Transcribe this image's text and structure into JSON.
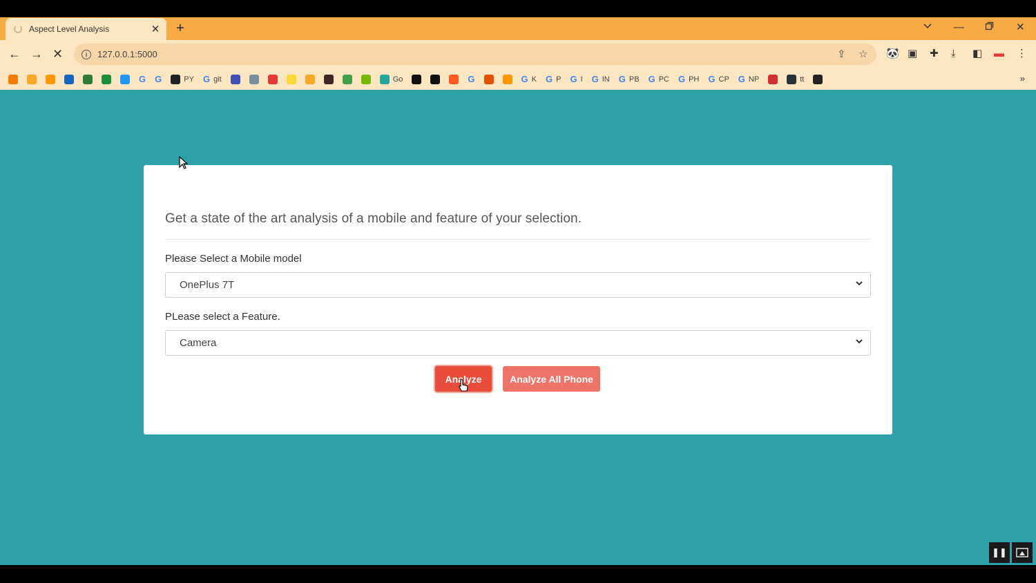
{
  "browser": {
    "tab_title": "Aspect Level Analysis",
    "url": "127.0.0.1:5000",
    "bookmarks": [
      {
        "icon": "arrow-fav-icon",
        "label": "",
        "color": "#f57c00"
      },
      {
        "icon": "orange-square-fav-icon",
        "label": "",
        "color": "#f9a825"
      },
      {
        "icon": "bars-fav-icon",
        "label": "",
        "color": "#ff9800"
      },
      {
        "icon": "ieee-fav-icon",
        "label": "",
        "color": "#1565c0"
      },
      {
        "icon": "green-circle-fav-icon",
        "label": "",
        "color": "#2e7d32"
      },
      {
        "icon": "plus-fav-icon",
        "label": "",
        "color": "#1b8e3a"
      },
      {
        "icon": "telegram-fav-icon",
        "label": "",
        "color": "#2196f3"
      },
      {
        "icon": "google-fav-icon",
        "label": "",
        "color": "#4285f4"
      },
      {
        "icon": "google-fav-icon",
        "label": "",
        "color": "#4285f4"
      },
      {
        "icon": "github-fav-icon",
        "label": "PY",
        "color": "#222222"
      },
      {
        "icon": "google-fav-icon",
        "label": "git",
        "color": "#4285f4"
      },
      {
        "icon": "blue-fav-icon",
        "label": "",
        "color": "#3f51b5"
      },
      {
        "icon": "stack-fav-icon",
        "label": "",
        "color": "#78909c"
      },
      {
        "icon": "youtube-fav-icon",
        "label": "",
        "color": "#e53935"
      },
      {
        "icon": "yellow-p-fav-icon",
        "label": "",
        "color": "#fdd835"
      },
      {
        "icon": "folder-fav-icon",
        "label": "",
        "color": "#f9a825"
      },
      {
        "icon": "dark-circle-fav-icon",
        "label": "",
        "color": "#3e2723"
      },
      {
        "icon": "green-ring-fav-icon",
        "label": "",
        "color": "#43a047"
      },
      {
        "icon": "nvidia-fav-icon",
        "label": "",
        "color": "#76b900"
      },
      {
        "icon": "web-fav-icon",
        "label": "Go",
        "color": "#26a69a"
      },
      {
        "icon": "notion-fav-icon",
        "label": "",
        "color": "#111111"
      },
      {
        "icon": "ci-fav-icon",
        "label": "",
        "color": "#111111"
      },
      {
        "icon": "r-fav-icon",
        "label": "",
        "color": "#ff5722"
      },
      {
        "icon": "google-fav-icon",
        "label": "",
        "color": "#4285f4"
      },
      {
        "icon": "a-fav-icon",
        "label": "",
        "color": "#e65100"
      },
      {
        "icon": "fish-fav-icon",
        "label": "",
        "color": "#ff9800"
      },
      {
        "icon": "google-fav-icon",
        "label": "K",
        "color": "#4285f4"
      },
      {
        "icon": "google-fav-icon",
        "label": "P",
        "color": "#4285f4"
      },
      {
        "icon": "google-fav-icon",
        "label": "I",
        "color": "#4285f4"
      },
      {
        "icon": "google-fav-icon",
        "label": "IN",
        "color": "#4285f4"
      },
      {
        "icon": "google-fav-icon",
        "label": "PB",
        "color": "#4285f4"
      },
      {
        "icon": "google-fav-icon",
        "label": "PC",
        "color": "#4285f4"
      },
      {
        "icon": "google-fav-icon",
        "label": "PH",
        "color": "#4285f4"
      },
      {
        "icon": "google-fav-icon",
        "label": "CP",
        "color": "#4285f4"
      },
      {
        "icon": "google-fav-icon",
        "label": "NP",
        "color": "#4285f4"
      },
      {
        "icon": "red-book-fav-icon",
        "label": "",
        "color": "#d32f2f"
      },
      {
        "icon": "bus-fav-icon",
        "label": "tt",
        "color": "#263238"
      },
      {
        "icon": "globe-fav-icon",
        "label": "",
        "color": "#222222"
      }
    ]
  },
  "page": {
    "headline": "Get a state of the art analysis of a mobile and feature of your selection.",
    "mobile_label": "Please Select a Mobile model",
    "mobile_value": "OnePlus 7T",
    "feature_label": "PLease select a Feature.",
    "feature_value": "Camera",
    "analyze_button": "Analyze",
    "analyze_all_button": "Analyze All Phone"
  },
  "colors": {
    "page_bg": "#2fa1a9",
    "tab_strip": "#f8aa45",
    "analyze": "#e94c3b",
    "analyze_all": "#ee7468"
  }
}
